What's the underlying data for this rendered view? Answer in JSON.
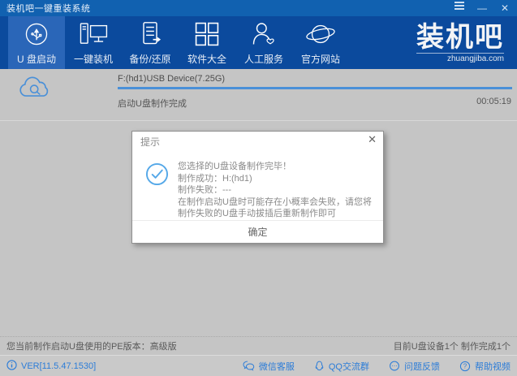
{
  "window": {
    "title": "装机吧一键重装系统",
    "controls": {
      "menu": "menu",
      "minimize": "—",
      "close": "✕"
    }
  },
  "nav": {
    "items": [
      {
        "label": "U 盘启动",
        "icon": "usb-icon",
        "active": true
      },
      {
        "label": "一键装机",
        "icon": "computer-icon",
        "active": false
      },
      {
        "label": "备份/还原",
        "icon": "backup-restore-icon",
        "active": false
      },
      {
        "label": "软件大全",
        "icon": "apps-grid-icon",
        "active": false
      },
      {
        "label": "人工服务",
        "icon": "person-service-icon",
        "active": false
      },
      {
        "label": "官方网站",
        "icon": "globe-icon",
        "active": false
      }
    ],
    "logo": {
      "text": "装机吧",
      "domain": "zhuangjiba.com"
    }
  },
  "task": {
    "device": "F:(hd1)USB Device(7.25G)",
    "status": "启动U盘制作完成",
    "elapsed": "00:05:19",
    "progress_percent": 100,
    "icon": "cloud-icon"
  },
  "dialog": {
    "title": "提示",
    "close": "✕",
    "icon": "check-circle-icon",
    "lines": [
      "您选择的U盘设备制作完毕！",
      "制作成功：H:(hd1)",
      "制作失败：---",
      "在制作启动U盘时可能存在小概率会失败，请您将制作失败的U盘手动拔插后重新制作即可"
    ],
    "ok_label": "确定"
  },
  "statusbar": {
    "left": "您当前制作启动U盘使用的PE版本：高级版",
    "right": "目前U盘设备1个 制作完成1个"
  },
  "footer": {
    "version": "VER[11.5.47.1530]",
    "links": [
      {
        "label": "微信客服",
        "icon": "wechat-icon"
      },
      {
        "label": "QQ交流群",
        "icon": "qq-icon"
      },
      {
        "label": "问题反馈",
        "icon": "feedback-icon"
      },
      {
        "label": "帮助视频",
        "icon": "help-icon"
      }
    ]
  },
  "colors": {
    "titlebar": "#1161b0",
    "nav": "#0b4a9d",
    "nav_active": "#2a66b8",
    "content_bg": "#c5c5c5",
    "progress": "#4a90d8",
    "accent_blue": "#55a8e8",
    "link_blue": "#2b7cd8"
  }
}
